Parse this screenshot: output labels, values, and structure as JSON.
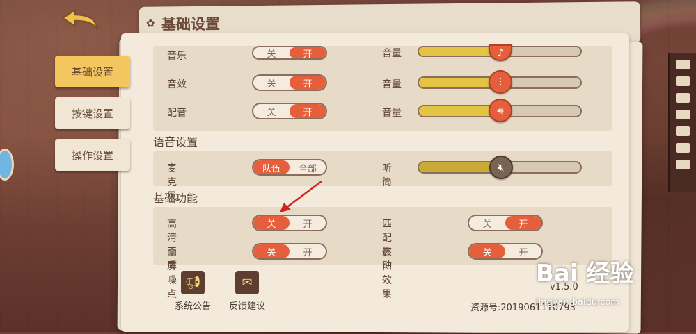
{
  "header": {
    "title": "基础设置"
  },
  "tabs": [
    {
      "label": "基础设置",
      "active": true
    },
    {
      "label": "按键设置",
      "active": false
    },
    {
      "label": "操作设置",
      "active": false
    }
  ],
  "audio_rows": [
    {
      "label": "音乐",
      "off": "关",
      "on": "开",
      "state": "on",
      "volume_label": "音量",
      "volume_level": 0.47,
      "knob_icon": "music-note-icon"
    },
    {
      "label": "音效",
      "off": "关",
      "on": "开",
      "state": "on",
      "volume_label": "音量",
      "volume_level": 0.47,
      "knob_icon": "equalizer-icon"
    },
    {
      "label": "配音",
      "off": "关",
      "on": "开",
      "state": "on",
      "volume_label": "音量",
      "volume_level": 0.47,
      "knob_icon": "speaker-icon"
    }
  ],
  "voice": {
    "section_title": "语音设置",
    "mic_label": "麦克风",
    "mic_option_team": "队伍",
    "mic_option_all": "全部",
    "mic_selected": "队伍",
    "listen_label": "听筒",
    "listen_level": 0.49,
    "listen_icon": "speaker-muted-icon"
  },
  "basic": {
    "section_title": "基础功能",
    "items": [
      {
        "label": "高清画质",
        "off": "关",
        "on": "开",
        "state": "off"
      },
      {
        "label": "匹配震动",
        "off": "关",
        "on": "开",
        "state": "on"
      },
      {
        "label": "全屏噪点",
        "off": "关",
        "on": "开",
        "state": "off"
      },
      {
        "label": "怀旧效果",
        "off": "关",
        "on": "开",
        "state": "off"
      }
    ]
  },
  "footer": {
    "announcement_label": "系统公告",
    "feedback_label": "反馈建议",
    "version": "v1.5.0",
    "resource": "资源号:2019061110793"
  },
  "watermark": {
    "logo": "Bai 经验",
    "url": "jingyan.baidu.com"
  },
  "colors": {
    "accent": "#e55f3d",
    "tab_active": "#f3c75d",
    "slider_fill": "#e4c443",
    "panel": "#e7dac6"
  }
}
